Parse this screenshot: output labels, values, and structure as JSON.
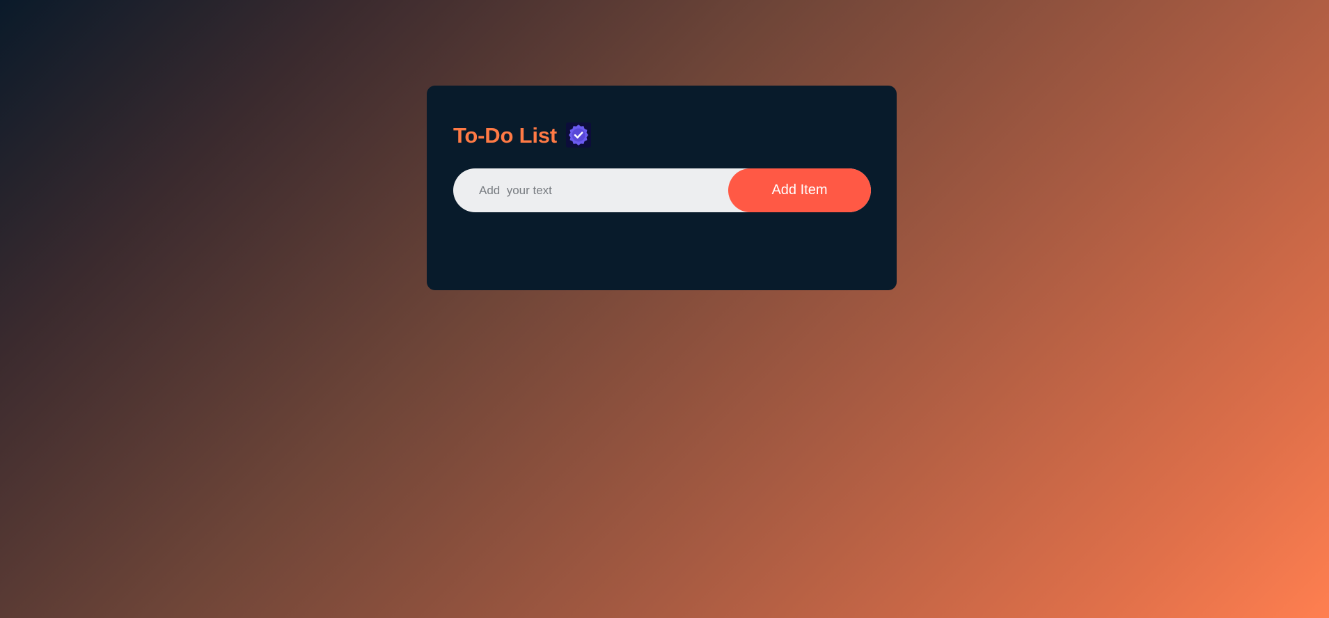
{
  "app": {
    "title": "To-Do List"
  },
  "icons": {
    "title_icon": "verified-badge-icon"
  },
  "input": {
    "value": "",
    "placeholder": "Add  your text"
  },
  "actions": {
    "add_label": "Add Item"
  },
  "list": {
    "items": []
  },
  "colors": {
    "title": "#ff7a45",
    "card_background": "#081b2b",
    "button": "#ff5945",
    "badge": "#6b5cf0",
    "input_background": "#edeef0"
  }
}
